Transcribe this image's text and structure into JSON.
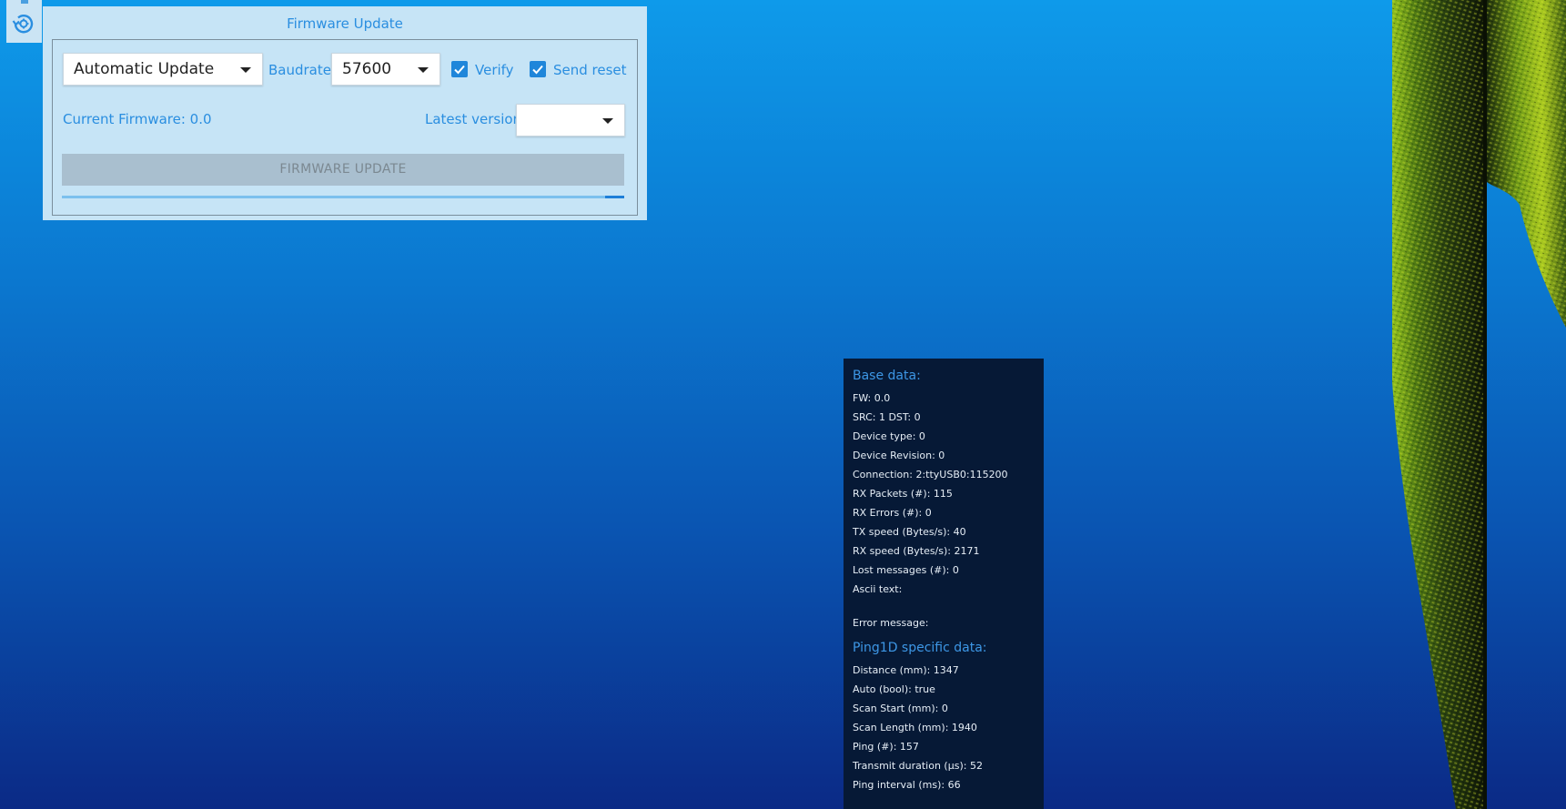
{
  "firmware_panel": {
    "title": "Firmware Update",
    "update_mode": "Automatic Update",
    "baudrate_label": "Baudrate:",
    "baudrate_value": "57600",
    "verify_label": "Verify",
    "verify_checked": true,
    "send_reset_label": "Send reset",
    "send_reset_checked": true,
    "current_firmware": "Current Firmware: 0.0",
    "latest_version_label": "Latest version:",
    "latest_version_value": "",
    "update_button": "FIRMWARE UPDATE"
  },
  "info_panel": {
    "base_header": "Base data:",
    "base_rows": [
      "FW: 0.0",
      "SRC: 1 DST: 0",
      "Device type: 0",
      "Device Revision: 0",
      "Connection: 2:ttyUSB0:115200",
      "RX Packets (#): 115",
      "RX Errors (#): 0",
      "TX speed (Bytes/s): 40",
      "RX speed (Bytes/s): 2171",
      "Lost messages (#): 0",
      "Ascii text:"
    ],
    "error_message": "Error message:",
    "specific_header": "Ping1D specific data:",
    "specific_rows": [
      "Distance (mm): 1347",
      "Auto (bool): true",
      "Scan Start (mm): 0",
      "Scan Length (mm): 1940",
      "Ping (#): 157",
      "Transmit duration (μs): 52",
      "Ping interval (ms): 66"
    ]
  },
  "colors": {
    "accent": "#2a8ee0",
    "panel_bg": "#c6e4f6",
    "info_bg": "#061936"
  },
  "icons": {
    "firmware_tool": "firmware-update-icon",
    "checkbox": "check-icon",
    "dropdown": "chevron-down-icon"
  }
}
